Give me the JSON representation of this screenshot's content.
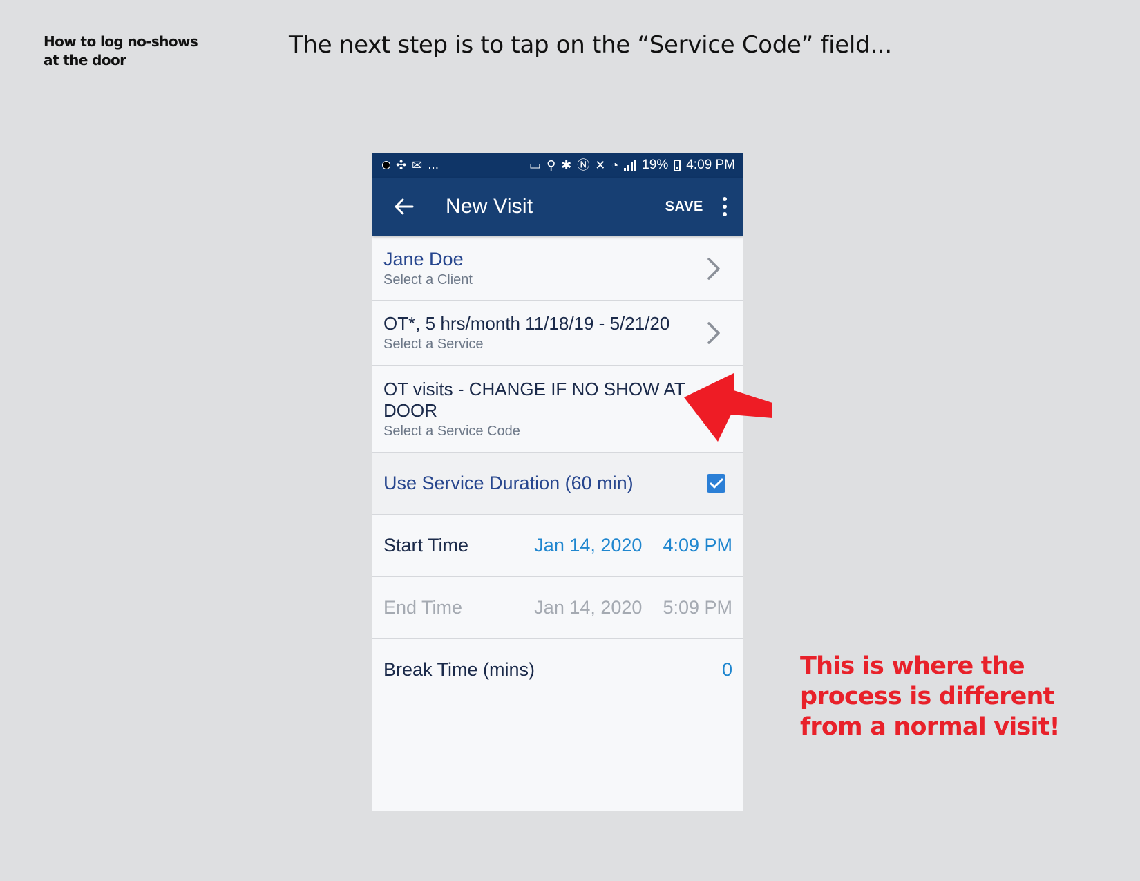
{
  "slide": {
    "label_line1": "How to log no-shows",
    "label_line2": "at the door",
    "heading": "The next step is to tap on the “Service Code” field...",
    "callout_line1": "This is where the",
    "callout_line2": "process is different",
    "callout_line3": "from a normal visit!",
    "callout_color": "#e8212a"
  },
  "status_bar": {
    "more": "...",
    "battery": "19%",
    "time": "4:09 PM"
  },
  "app_bar": {
    "title": "New Visit",
    "save_label": "SAVE",
    "back_icon": "arrow-left-icon",
    "more_icon": "more-vert-icon",
    "color": "#173f73"
  },
  "form": {
    "client": {
      "value": "Jane Doe",
      "hint": "Select a Client"
    },
    "service": {
      "value": "OT*, 5 hrs/month 11/18/19 - 5/21/20",
      "hint": "Select a Service"
    },
    "service_code": {
      "value_line1": "OT visits - CHANGE IF NO SHOW AT",
      "value_line2": "DOOR",
      "hint": "Select a Service Code"
    },
    "use_duration": {
      "label": "Use Service Duration (60 min)",
      "checked": true
    },
    "start_time": {
      "label": "Start Time",
      "date": "Jan 14, 2020",
      "time": "4:09 PM"
    },
    "end_time": {
      "label": "End Time",
      "date": "Jan 14, 2020",
      "time": "5:09 PM"
    },
    "break_time": {
      "label": "Break Time (mins)",
      "value": "0"
    }
  }
}
